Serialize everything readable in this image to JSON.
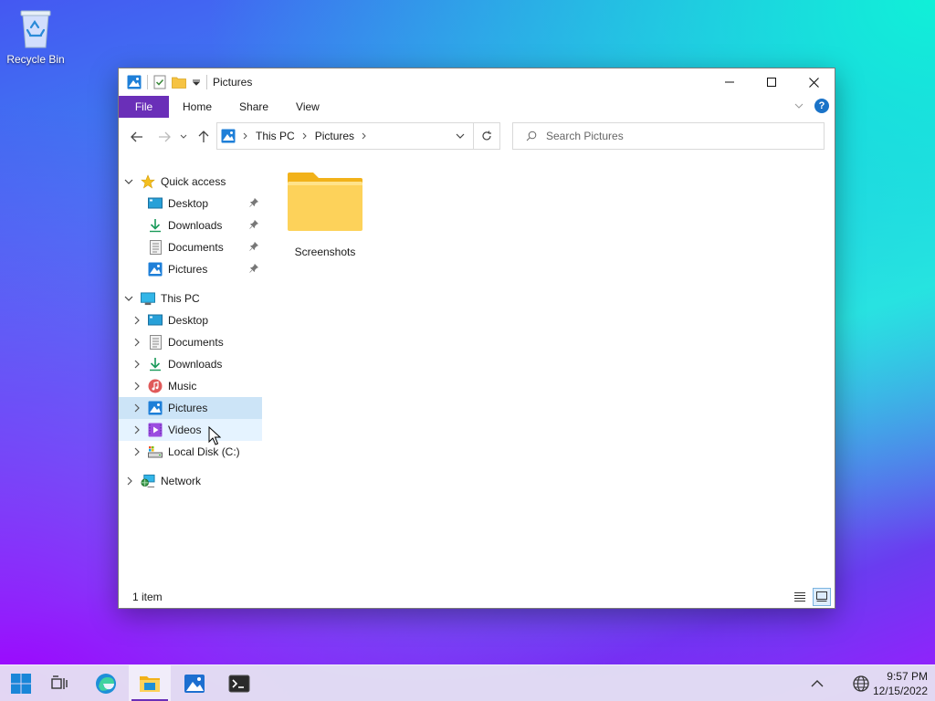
{
  "desktop": {
    "recycle_bin_label": "Recycle Bin"
  },
  "window": {
    "title": "Pictures",
    "ribbon_tabs": [
      "File",
      "Home",
      "Share",
      "View"
    ],
    "help_label": "?",
    "breadcrumb": [
      "This PC",
      "Pictures"
    ],
    "search_placeholder": "Search Pictures",
    "nav_tree": {
      "quick_access": {
        "label": "Quick access",
        "items": [
          "Desktop",
          "Downloads",
          "Documents",
          "Pictures"
        ]
      },
      "this_pc": {
        "label": "This PC",
        "items": [
          "Desktop",
          "Documents",
          "Downloads",
          "Music",
          "Pictures",
          "Videos",
          "Local Disk (C:)"
        ]
      },
      "network_label": "Network"
    },
    "content_items": [
      {
        "name": "Screenshots",
        "type": "folder"
      }
    ],
    "status_text": "1 item",
    "selected_nav": "Pictures",
    "accent_color": "#6a2fb8"
  },
  "taskbar": {
    "time": "9:57 PM",
    "date": "12/15/2022"
  }
}
